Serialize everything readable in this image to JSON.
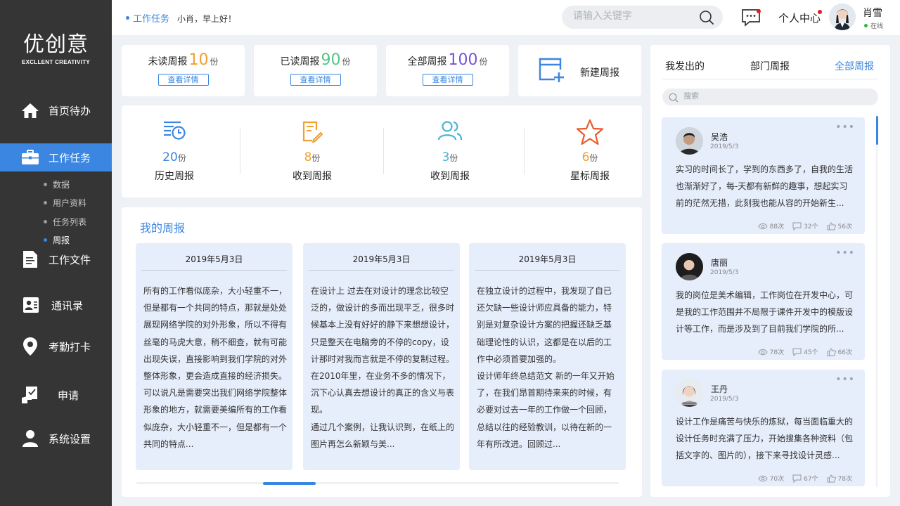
{
  "sidebar": {
    "logo_main": "优创意",
    "logo_sub": "EXCLLENT CREATIVITY",
    "items": [
      {
        "label": "首页待办"
      },
      {
        "label": "工作任务"
      },
      {
        "label": "工作文件"
      },
      {
        "label": "通讯录"
      },
      {
        "label": "考勤打卡"
      },
      {
        "label": "申请"
      },
      {
        "label": "系统设置"
      }
    ],
    "sub_items": [
      {
        "label": "数据"
      },
      {
        "label": "用户资料"
      },
      {
        "label": "任务列表"
      },
      {
        "label": "周报"
      }
    ]
  },
  "header": {
    "breadcrumb": "工作任务",
    "greeting": "小肖，早上好！",
    "search_placeholder": "请输入关键字",
    "personal_center": "个人中心",
    "user_name": "肖雪",
    "user_status": "在线"
  },
  "stats": [
    {
      "label": "未读周报",
      "value": "10",
      "unit": "份",
      "color": "#f0a030",
      "button": "查看详情"
    },
    {
      "label": "已读周报",
      "value": "90",
      "unit": "份",
      "color": "#55c489",
      "button": "查看详情"
    },
    {
      "label": "全部周报",
      "value": "100",
      "unit": "份",
      "color": "#7a52d6",
      "button": "查看详情"
    }
  ],
  "new_report": {
    "label": "新建周报"
  },
  "categories": [
    {
      "value": "20",
      "unit": "份",
      "label": "历史周报",
      "color": "#3b86e0",
      "icon": "history-list-icon"
    },
    {
      "value": "8",
      "unit": "份",
      "label": "收到周报",
      "color": "#f0a030",
      "icon": "document-edit-icon"
    },
    {
      "value": "3",
      "unit": "份",
      "label": "收到周报",
      "color": "#4ab1d8",
      "icon": "users-icon"
    },
    {
      "value": "6",
      "unit": "份",
      "label": "星标周报",
      "color": "#f0a030",
      "icon": "star-icon"
    }
  ],
  "my_reports": {
    "title": "我的周报",
    "items": [
      {
        "date": "2019年5月3日",
        "body": "所有的工作看似庞杂，大小轻重不一，\n但是都有一个共同的特点，那就是处处\n展现网络学院的对外形象，所以不得有\n丝毫的马虎大意，稍不细查，就有可能\n出现失误，直接影响到我们学院的对外\n整体形象，更会造成直接的经济损失。\n可以说凡是需要突出我们网络学院整体\n形象的地方，就需要美编所有的工作看\n似庞杂，大小轻重不一，但是都有一个\n共同的特点..."
      },
      {
        "date": "2019年5月3日",
        "body": "在设计上 过去在对设计的理念比较空\n泛的，做设计的多而出现平乏，很多时\n候基本上没有好好的静下来想想设计，\n只是整天在电脑旁的不停的copy，设\n计那时对我而言就是不停的复制过程。\n在2010年里，在业务不多的情况下，\n沉下心认真去想设计的真正的含义与表\n现。\n通过几个案例，让我认识到，在纸上的\n图片再怎么新颖与美..."
      },
      {
        "date": "2019年5月3日",
        "body": "在独立设计的过程中，我发现了自已\n还欠缺一些设计师应具备的能力，特\n别是对复杂设计方案的把握还缺乏基\n础理论性的认识，这都是在以后的工\n作中必须首要加强的。\n设计师年终总结范文 新的一年又开始\n了，在我们昂首期待来来的时候，有\n必要对过去一年的工作做一个回顾，\n总结以往的经验教训，以待在新的一\n年有所改进。回顾过..."
      }
    ]
  },
  "right_panel": {
    "tabs": [
      {
        "label": "我发出的"
      },
      {
        "label": "部门周报"
      },
      {
        "label": "全部周报"
      }
    ],
    "search_placeholder": "搜索",
    "feed": [
      {
        "name": "吴浩",
        "date": "2019/5/3",
        "text": "实习的时间长了，学到的东西多了，自我的生活也渐渐好了，每-天都有新鲜的趣事，想起实习前的茫然无措，此刻我也能从容的开始新生...",
        "views": "88次",
        "comments": "32个",
        "likes": "56次"
      },
      {
        "name": "唐丽",
        "date": "2019/5/3",
        "text": "我的岗位是美术编辑，工作岗位在开发中心，可是我的工作范围并不局限于课件开发中的模版设计等工作，而是涉及到了目前我们学院的所...",
        "views": "78次",
        "comments": "45个",
        "likes": "66次"
      },
      {
        "name": "王丹",
        "date": "2019/5/3",
        "text": "设计工作是痛苦与快乐的炼狱，每当面临重大的设计任务时充满了压力，开始搜集各种资料（包括文字的、图片的），接下来寻找设计灵感...",
        "views": "70次",
        "comments": "67个",
        "likes": "78次"
      }
    ]
  },
  "colors": {
    "accent": "#3b86e0",
    "sidebar_bg": "#353535",
    "card_tint": "#e6edfb"
  }
}
